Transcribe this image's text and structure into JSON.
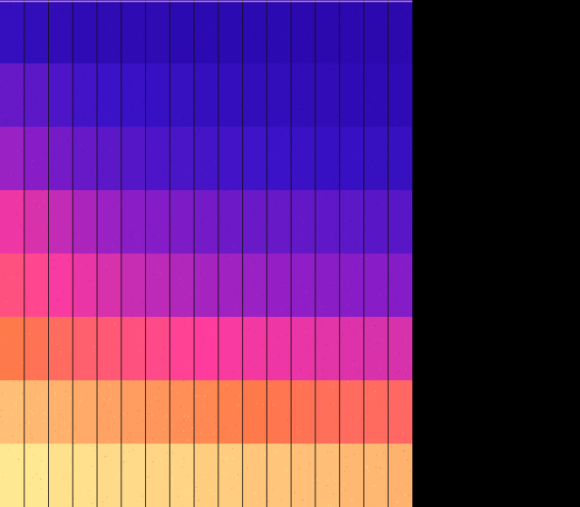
{
  "chart_data": {
    "type": "heatmap",
    "title": "",
    "xlabel": "",
    "ylabel": "",
    "columns": 17,
    "rows": 8,
    "column_dividers": 17,
    "value_range": [
      0,
      1
    ],
    "grid": true,
    "legend": "none",
    "band_rows": [
      {
        "label": "",
        "intensity": [
          0.18,
          0.16,
          0.15,
          0.14,
          0.13,
          0.13,
          0.13,
          0.12,
          0.12,
          0.12,
          0.12,
          0.12,
          0.11,
          0.11,
          0.11,
          0.11,
          0.11
        ]
      },
      {
        "label": "",
        "intensity": [
          0.34,
          0.31,
          0.27,
          0.24,
          0.22,
          0.21,
          0.2,
          0.19,
          0.18,
          0.17,
          0.16,
          0.16,
          0.15,
          0.15,
          0.14,
          0.14,
          0.14
        ]
      },
      {
        "label": "",
        "intensity": [
          0.47,
          0.43,
          0.38,
          0.34,
          0.31,
          0.29,
          0.27,
          0.26,
          0.25,
          0.24,
          0.23,
          0.22,
          0.21,
          0.2,
          0.2,
          0.19,
          0.19
        ]
      },
      {
        "label": "",
        "intensity": [
          0.62,
          0.58,
          0.54,
          0.5,
          0.47,
          0.44,
          0.42,
          0.4,
          0.38,
          0.36,
          0.35,
          0.34,
          0.33,
          0.32,
          0.31,
          0.3,
          0.3
        ]
      },
      {
        "label": "",
        "intensity": [
          0.71,
          0.68,
          0.64,
          0.61,
          0.58,
          0.55,
          0.53,
          0.51,
          0.49,
          0.48,
          0.47,
          0.46,
          0.45,
          0.44,
          0.43,
          0.43,
          0.42
        ]
      },
      {
        "label": "",
        "intensity": [
          0.82,
          0.8,
          0.78,
          0.75,
          0.73,
          0.71,
          0.69,
          0.67,
          0.65,
          0.64,
          0.63,
          0.62,
          0.61,
          0.6,
          0.59,
          0.58,
          0.58
        ]
      },
      {
        "label": "",
        "intensity": [
          0.92,
          0.91,
          0.9,
          0.89,
          0.88,
          0.87,
          0.86,
          0.85,
          0.84,
          0.83,
          0.82,
          0.81,
          0.8,
          0.79,
          0.78,
          0.78,
          0.77
        ]
      },
      {
        "label": "",
        "intensity": [
          0.98,
          0.98,
          0.97,
          0.97,
          0.96,
          0.96,
          0.95,
          0.95,
          0.94,
          0.94,
          0.93,
          0.93,
          0.92,
          0.92,
          0.91,
          0.91,
          0.9
        ]
      }
    ],
    "colors": {
      "low": "#1a0096",
      "mid_low": "#3b12c7",
      "mid": "#8f1ec7",
      "high_mid": "#ff3b9e",
      "high": "#ff7a4a",
      "max": "#fff69a",
      "divider": "#111111",
      "background": "#000000"
    }
  }
}
